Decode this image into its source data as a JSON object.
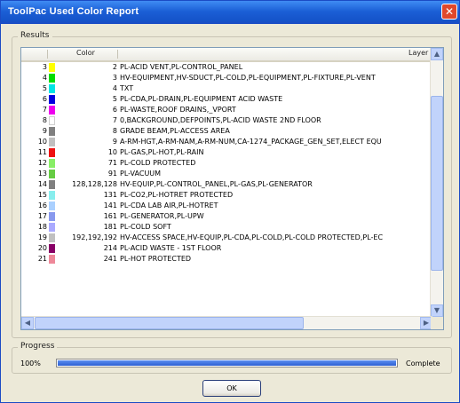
{
  "window": {
    "title": "ToolPac Used Color Report",
    "close_glyph": "✕"
  },
  "results": {
    "group_label": "Results",
    "columns": [
      "Color",
      "Layer"
    ],
    "rows": [
      {
        "index": "3",
        "color": "#ffff00",
        "value": "2",
        "layers": "PL-ACID VENT,PL-CONTROL_PANEL"
      },
      {
        "index": "4",
        "color": "#00dd00",
        "value": "3",
        "layers": "HV-EQUIPMENT,HV-SDUCT,PL-COLD,PL-EQUIPMENT,PL-FIXTURE,PL-VENT"
      },
      {
        "index": "5",
        "color": "#00e5e5",
        "value": "4",
        "layers": "TXT"
      },
      {
        "index": "6",
        "color": "#0000e0",
        "value": "5",
        "layers": "PL-CDA,PL-DRAIN,PL-EQUIPMENT ACID WASTE"
      },
      {
        "index": "7",
        "color": "#ee00ee",
        "value": "6",
        "layers": "PL-WASTE,ROOF DRAINS,_VPORT"
      },
      {
        "index": "8",
        "color": "#ffffff",
        "value": "7",
        "layers": "0,BACKGROUND,DEFPOINTS,PL-ACID WASTE 2ND FLOOR"
      },
      {
        "index": "9",
        "color": "#808080",
        "value": "8",
        "layers": "GRADE BEAM,PL-ACCESS AREA"
      },
      {
        "index": "10",
        "color": "#c0c0c0",
        "value": "9",
        "layers": "A-RM-HGT,A-RM-NAM,A-RM-NUM,CA-1274_PACKAGE_GEN_SET,ELECT EQU"
      },
      {
        "index": "11",
        "color": "#ee1111",
        "value": "10",
        "layers": "PL-GAS,PL-HOT,PL-RAIN"
      },
      {
        "index": "12",
        "color": "#88ee66",
        "value": "71",
        "layers": "PL-COLD PROTECTED"
      },
      {
        "index": "13",
        "color": "#66cc44",
        "value": "91",
        "layers": "PL-VACUUM"
      },
      {
        "index": "14",
        "color": "#808080",
        "value": "128,128,128",
        "layers": "HV-EQUIP,PL-CONTROL_PANEL,PL-GAS,PL-GENERATOR"
      },
      {
        "index": "15",
        "color": "#88eeee",
        "value": "131",
        "layers": "PL-CO2,PL-HOTRET PROTECTED"
      },
      {
        "index": "16",
        "color": "#aad0ff",
        "value": "141",
        "layers": "PL-CDA LAB AIR,PL-HOTRET"
      },
      {
        "index": "17",
        "color": "#8899ee",
        "value": "161",
        "layers": "PL-GENERATOR,PL-UPW"
      },
      {
        "index": "18",
        "color": "#aaaaff",
        "value": "181",
        "layers": "PL-COLD SOFT"
      },
      {
        "index": "19",
        "color": "#c0c0c0",
        "value": "192,192,192",
        "layers": "HV-ACCESS SPACE,HV-EQUIP,PL-CDA,PL-COLD,PL-COLD PROTECTED,PL-EC"
      },
      {
        "index": "20",
        "color": "#880066",
        "value": "214",
        "layers": "PL-ACID WASTE - 1ST FLOOR"
      },
      {
        "index": "21",
        "color": "#ee8899",
        "value": "241",
        "layers": "PL-HOT PROTECTED"
      }
    ],
    "scroll_up_glyph": "▲",
    "scroll_down_glyph": "▼",
    "scroll_left_glyph": "◀",
    "scroll_right_glyph": "▶"
  },
  "progress": {
    "group_label": "Progress",
    "percent_text": "100%",
    "value": 1.0,
    "status": "Complete"
  },
  "ok_label": "OK",
  "colors": {
    "titlebar": "#1b5fd6",
    "progress_fill": "#2d5fd3"
  }
}
